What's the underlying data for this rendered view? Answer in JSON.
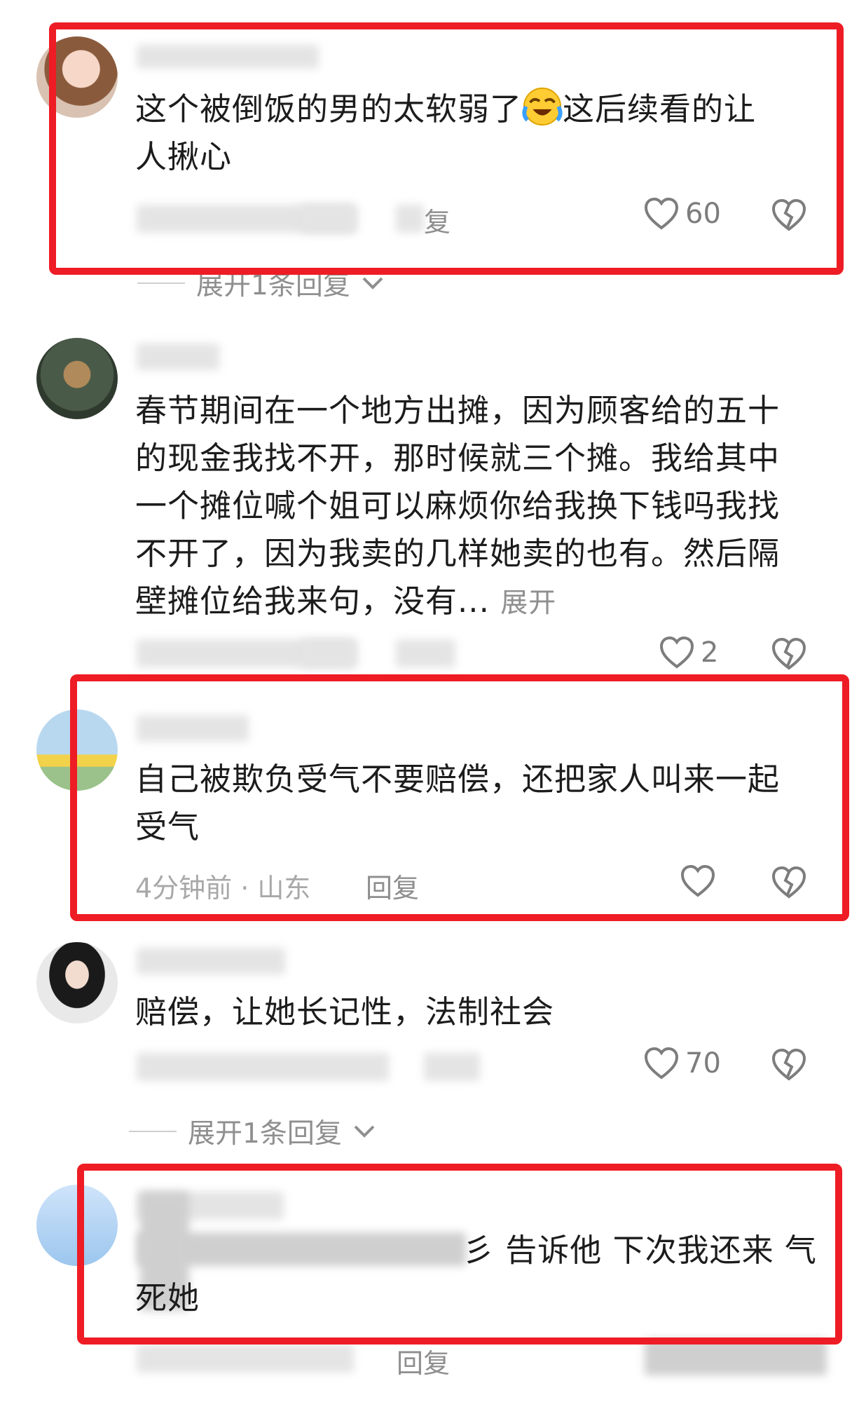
{
  "comments": [
    {
      "text_a": "这个被倒饭的男的太软弱了",
      "emoji": "crying-laughing-emoji",
      "text_b": "这后续看的让\n人揪心",
      "reply": "复",
      "likes": "60",
      "expand": "展开1条回复"
    },
    {
      "text": "春节期间在一个地方出摊，因为顾客给的五十\n的现金我找不开，那时候就三个摊。我给其中\n一个摊位喊个姐可以麻烦你给我换下钱吗我找\n不开了，因为我卖的几样她卖的也有。然后隔\n壁摊位给我来句，没有...",
      "more": "展开",
      "likes": "2"
    },
    {
      "text": "自己被欺负受气不要赔偿，还把家人叫来一起\n受气",
      "meta": "4分钟前 · 山东",
      "reply": "回复"
    },
    {
      "text": "赔偿，让她长记性，法制社会",
      "likes": "70",
      "expand": "展开1条回复"
    },
    {
      "text_a": "彡 告诉他 下次我还来 气",
      "text_b": "死她",
      "reply": "回复"
    }
  ],
  "colors": {
    "highlight_box": "#ee1c24",
    "text": "#1c1c1c",
    "muted": "#a8a8a8"
  },
  "icons": [
    "heart-icon",
    "broken-heart-icon",
    "chevron-down-icon"
  ]
}
